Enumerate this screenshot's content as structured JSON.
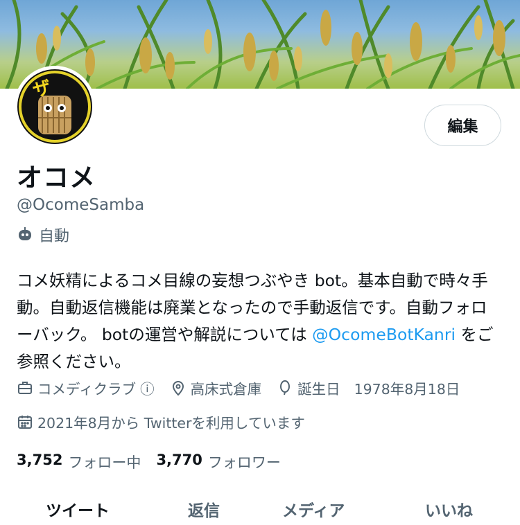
{
  "profile": {
    "display_name": "オコメ",
    "handle": "@OcomeSamba",
    "automated_label": "自動",
    "edit_button": "編集",
    "avatar_text": "ザ"
  },
  "bio": {
    "text_before_link": "コメ妖精によるコメ目線の妄想つぶやき bot。基本自動で時々手動。自動返信機能は廃業となったので手動返信です。自動フォローバック。 botの運営や解説については ",
    "link": "@OcomeBotKanri",
    "text_after_link": " をご参照ください。"
  },
  "meta": {
    "category": "コメディクラブ",
    "info_icon": "ⓘ",
    "location": "高床式倉庫",
    "birthday_label": "誕生日",
    "birthday": "1978年8月18日",
    "joined": "2021年8月から Twitterを利用しています"
  },
  "stats": {
    "following_count": "3,752",
    "following_label": "フォロー中",
    "followers_count": "3,770",
    "followers_label": "フォロワー"
  },
  "tabs": [
    {
      "label": "ツイート",
      "active": true
    },
    {
      "label": "返信",
      "active": false
    },
    {
      "label": "メディア",
      "active": false
    },
    {
      "label": "いいね",
      "active": false
    }
  ],
  "colors": {
    "link": "#1d9bf0",
    "secondary_text": "#536471",
    "primary_text": "#0f1419"
  },
  "icons": {
    "automated": "robot-icon",
    "category": "briefcase-icon",
    "location": "location-pin-icon",
    "birthday": "balloon-icon",
    "joined": "calendar-icon"
  }
}
